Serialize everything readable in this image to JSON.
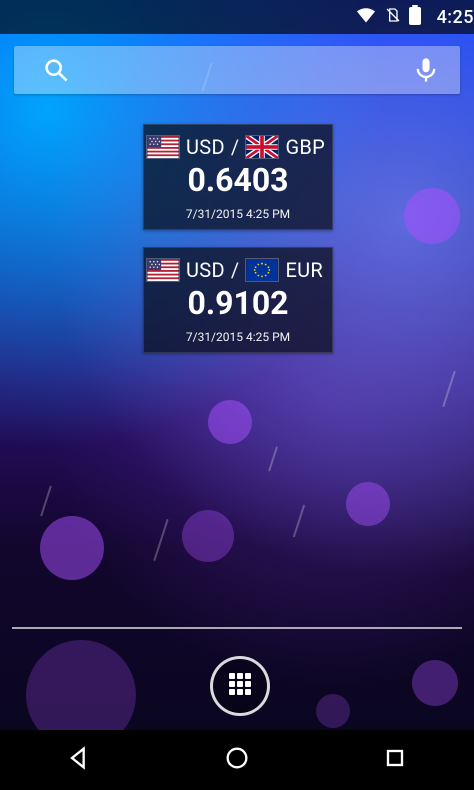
{
  "status_bar": {
    "time": "4:25",
    "icons": [
      "wifi-icon",
      "no-sim-icon",
      "battery-icon"
    ]
  },
  "search": {
    "placeholder": "",
    "left_icon": "search-icon",
    "right_icon": "microphone-icon"
  },
  "widgets": [
    {
      "from_currency": "USD",
      "to_currency": "GBP",
      "separator": "/",
      "rate": "0.6403",
      "timestamp": "7/31/2015 4:25 PM",
      "from_flag": "us-flag-icon",
      "to_flag": "uk-flag-icon"
    },
    {
      "from_currency": "USD",
      "to_currency": "EUR",
      "separator": "/",
      "rate": "0.9102",
      "timestamp": "7/31/2015 4:25 PM",
      "from_flag": "us-flag-icon",
      "to_flag": "eu-flag-icon"
    }
  ],
  "dock": {
    "app_drawer_icon": "app-drawer-icon"
  },
  "nav_bar": {
    "back_icon": "back-icon",
    "home_icon": "home-icon",
    "recents_icon": "recents-icon"
  },
  "colors": {
    "status_bar_bg": "#000000",
    "widget_bg": "#0A0C19",
    "text": "#FFFFFF"
  }
}
